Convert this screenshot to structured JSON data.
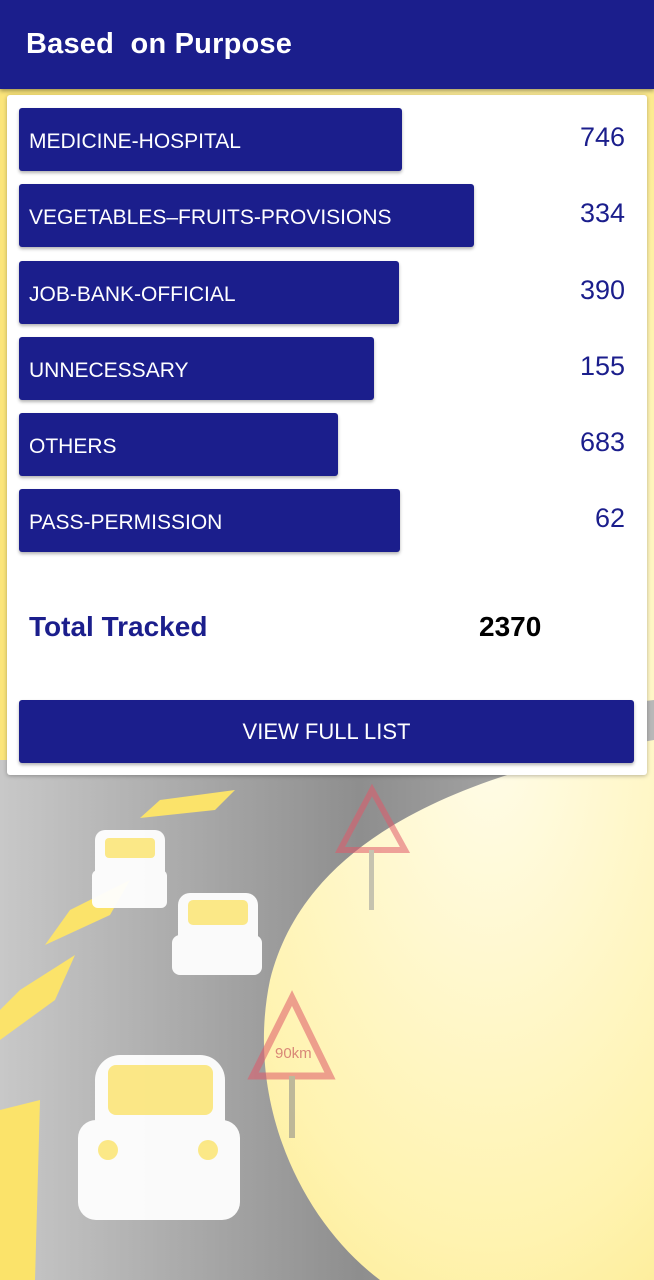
{
  "appbar": {
    "title": "Based  on Purpose"
  },
  "purposes": [
    {
      "label": "MEDICINE-HOSPITAL",
      "count": "746"
    },
    {
      "label": "VEGETABLES–FRUITS-PROVISIONS",
      "count": "334"
    },
    {
      "label": "JOB-BANK-OFFICIAL",
      "count": "390"
    },
    {
      "label": "UNNECESSARY",
      "count": "155"
    },
    {
      "label": "OTHERS",
      "count": "683"
    },
    {
      "label": "PASS-PERMISSION",
      "count": "62"
    }
  ],
  "total": {
    "label": "Total Tracked",
    "value": "2370"
  },
  "actions": {
    "view_full_list": "VIEW FULL LIST"
  },
  "background": {
    "sign_text": "90km"
  },
  "colors": {
    "primary": "#1b1e8c",
    "background": "#fff6c8",
    "road": "#9a9a9a"
  }
}
